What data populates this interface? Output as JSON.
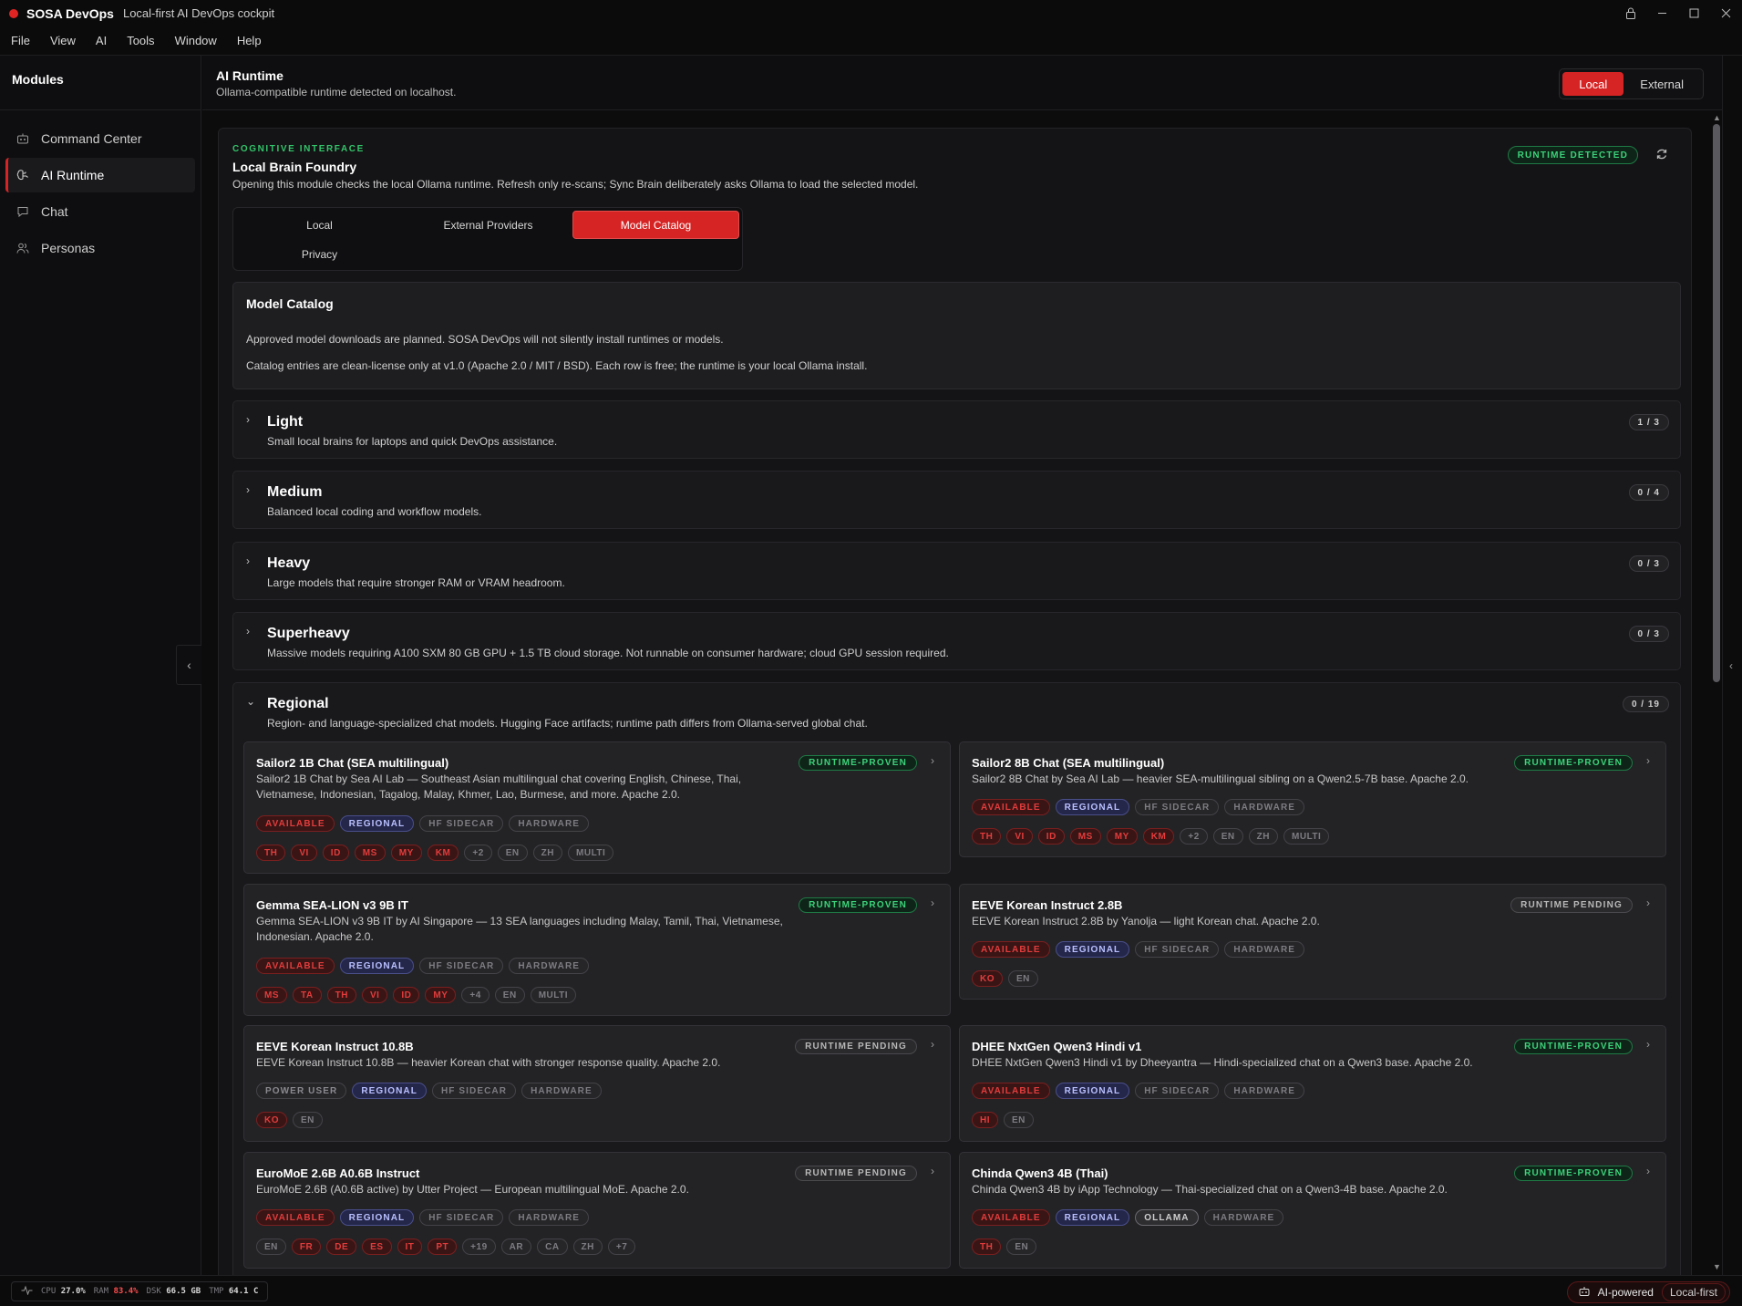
{
  "titlebar": {
    "app_name": "SOSA DevOps",
    "app_subtitle": "Local-first AI DevOps cockpit"
  },
  "menu": [
    "File",
    "View",
    "AI",
    "Tools",
    "Window",
    "Help"
  ],
  "sidebar": {
    "title": "Modules",
    "items": [
      {
        "label": "Command Center",
        "icon": "robot-icon"
      },
      {
        "label": "AI Runtime",
        "icon": "brain-icon"
      },
      {
        "label": "Chat",
        "icon": "chat-bubble-icon"
      },
      {
        "label": "Personas",
        "icon": "users-icon"
      }
    ],
    "active": "AI Runtime"
  },
  "header": {
    "title": "AI Runtime",
    "subtitle": "Ollama-compatible runtime detected on localhost.",
    "modes": [
      "Local",
      "External"
    ],
    "active_mode": "Local"
  },
  "panel": {
    "eyebrow": "COGNITIVE INTERFACE",
    "title": "Local Brain Foundry",
    "description": "Opening this module checks the local Ollama runtime. Refresh only re-scans; Sync Brain deliberately asks Ollama to load the selected model.",
    "status_badge": "RUNTIME DETECTED",
    "tabs": [
      "Local",
      "External Providers",
      "Model Catalog",
      "Privacy"
    ],
    "active_tab": "Model Catalog"
  },
  "catalog": {
    "title": "Model Catalog",
    "p1": "Approved model downloads are planned. SOSA DevOps will not silently install runtimes or models.",
    "p2": "Catalog entries are clean-license only at v1.0 (Apache 2.0 / MIT / BSD). Each row is free; the runtime is your local Ollama install."
  },
  "tiers": [
    {
      "name": "Light",
      "description": "Small local brains for laptops and quick DevOps assistance.",
      "count": "1 / 3",
      "expanded": false
    },
    {
      "name": "Medium",
      "description": "Balanced local coding and workflow models.",
      "count": "0 / 4",
      "expanded": false
    },
    {
      "name": "Heavy",
      "description": "Large models that require stronger RAM or VRAM headroom.",
      "count": "0 / 3",
      "expanded": false
    },
    {
      "name": "Superheavy",
      "description": "Massive models requiring A100 SXM 80 GB GPU + 1.5 TB cloud storage. Not runnable on consumer hardware; cloud GPU session required.",
      "count": "0 / 3",
      "expanded": false
    },
    {
      "name": "Regional",
      "description": "Region- and language-specialized chat models. Hugging Face artifacts; runtime path differs from Ollama-served global chat.",
      "count": "0 / 19",
      "expanded": true
    }
  ],
  "models": [
    {
      "title": "Sailor2 1B Chat (SEA multilingual)",
      "description": "Sailor2 1B Chat by Sea AI Lab — Southeast Asian multilingual chat covering English, Chinese, Thai, Vietnamese, Indonesian, Tagalog, Malay, Khmer, Lao, Burmese, and more. Apache 2.0.",
      "status": "RUNTIME-PROVEN",
      "chips": [
        "AVAILABLE",
        "REGIONAL",
        "HF SIDECAR",
        "HARDWARE"
      ],
      "langs": [
        "TH",
        "VI",
        "ID",
        "MS",
        "MY",
        "KM",
        "+2",
        "EN",
        "ZH",
        "MULTI"
      ]
    },
    {
      "title": "Sailor2 8B Chat (SEA multilingual)",
      "description": "Sailor2 8B Chat by Sea AI Lab — heavier SEA-multilingual sibling on a Qwen2.5-7B base. Apache 2.0.",
      "status": "RUNTIME-PROVEN",
      "chips": [
        "AVAILABLE",
        "REGIONAL",
        "HF SIDECAR",
        "HARDWARE"
      ],
      "langs": [
        "TH",
        "VI",
        "ID",
        "MS",
        "MY",
        "KM",
        "+2",
        "EN",
        "ZH",
        "MULTI"
      ]
    },
    {
      "title": "Gemma SEA-LION v3 9B IT",
      "description": "Gemma SEA-LION v3 9B IT by AI Singapore — 13 SEA languages including Malay, Tamil, Thai, Vietnamese, Indonesian. Apache 2.0.",
      "status": "RUNTIME-PROVEN",
      "chips": [
        "AVAILABLE",
        "REGIONAL",
        "HF SIDECAR",
        "HARDWARE"
      ],
      "langs": [
        "MS",
        "TA",
        "TH",
        "VI",
        "ID",
        "MY",
        "+4",
        "EN",
        "MULTI"
      ]
    },
    {
      "title": "EEVE Korean Instruct 2.8B",
      "description": "EEVE Korean Instruct 2.8B by Yanolja — light Korean chat. Apache 2.0.",
      "status": "RUNTIME PENDING",
      "chips": [
        "AVAILABLE",
        "REGIONAL",
        "HF SIDECAR",
        "HARDWARE"
      ],
      "langs": [
        "KO",
        "EN"
      ]
    },
    {
      "title": "EEVE Korean Instruct 10.8B",
      "description": "EEVE Korean Instruct 10.8B — heavier Korean chat with stronger response quality. Apache 2.0.",
      "status": "RUNTIME PENDING",
      "chips": [
        "POWER USER",
        "REGIONAL",
        "HF SIDECAR",
        "HARDWARE"
      ],
      "langs": [
        "KO",
        "EN"
      ]
    },
    {
      "title": "DHEE NxtGen Qwen3 Hindi v1",
      "description": "DHEE NxtGen Qwen3 Hindi v1 by Dheeyantra — Hindi-specialized chat on a Qwen3 base. Apache 2.0.",
      "status": "RUNTIME-PROVEN",
      "chips": [
        "AVAILABLE",
        "REGIONAL",
        "HF SIDECAR",
        "HARDWARE"
      ],
      "langs": [
        "HI",
        "EN"
      ]
    },
    {
      "title": "EuroMoE 2.6B A0.6B Instruct",
      "description": "EuroMoE 2.6B (A0.6B active) by Utter Project — European multilingual MoE. Apache 2.0.",
      "status": "RUNTIME PENDING",
      "chips": [
        "AVAILABLE",
        "REGIONAL",
        "HF SIDECAR",
        "HARDWARE"
      ],
      "langs": [
        "EN",
        "FR",
        "DE",
        "ES",
        "IT",
        "PT",
        "+19",
        "AR",
        "CA",
        "ZH",
        "+7"
      ]
    },
    {
      "title": "Chinda Qwen3 4B (Thai)",
      "description": "Chinda Qwen3 4B by iApp Technology — Thai-specialized chat on a Qwen3-4B base. Apache 2.0.",
      "status": "RUNTIME-PROVEN",
      "chips": [
        "AVAILABLE",
        "REGIONAL",
        "OLLAMA",
        "HARDWARE"
      ],
      "langs": [
        "TH",
        "EN"
      ]
    }
  ],
  "statusbar": {
    "metrics": [
      {
        "label": "CPU",
        "value": "27.0%",
        "hot": false
      },
      {
        "label": "RAM",
        "value": "83.4%",
        "hot": true
      },
      {
        "label": "DSK",
        "value": "66.5 GB",
        "hot": false
      },
      {
        "label": "TMP",
        "value": "64.1 C",
        "hot": false
      }
    ],
    "ai_label": "AI-powered",
    "ai_mode": "Local-first"
  },
  "colors": {
    "accent": "#d62424",
    "proven": "#3bd37a",
    "regional": "#b9c0ff",
    "background": "#0c0c0d"
  }
}
